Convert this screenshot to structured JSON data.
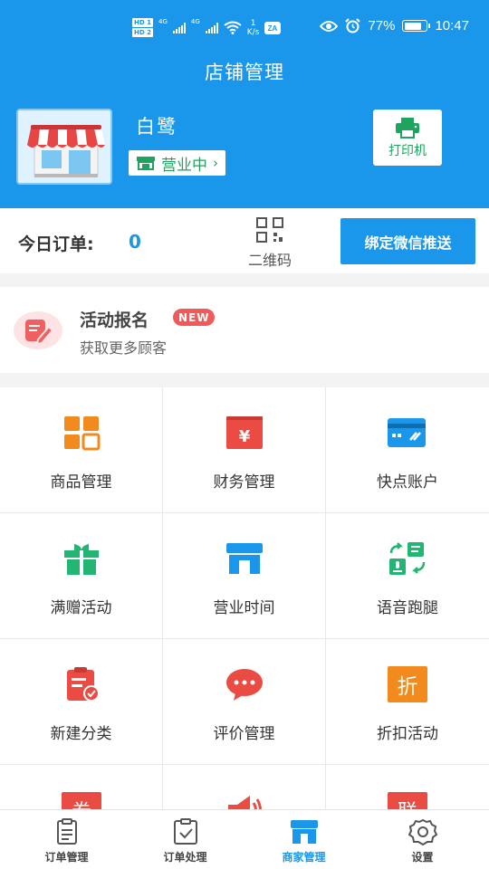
{
  "status_bar": {
    "hd1": "HD 1",
    "hd2": "HD 2",
    "net1": "4G",
    "net2": "4G",
    "speed_value": "1",
    "speed_unit": "K/s",
    "battery": "77%",
    "time": "10:47"
  },
  "header": {
    "title": "店铺管理",
    "shop_name": "白鹭",
    "open_status": "营业中",
    "printer_label": "打印机"
  },
  "orders": {
    "label": "今日订单:",
    "count": "0",
    "qr_label": "二维码",
    "wechat_button": "绑定微信推送"
  },
  "activity": {
    "title": "活动报名",
    "badge": "NEW",
    "subtitle": "获取更多顾客"
  },
  "grid": [
    {
      "label": "商品管理",
      "icon": "goods-grid-icon",
      "color": "#f28a1e"
    },
    {
      "label": "财务管理",
      "icon": "finance-yen-icon",
      "color": "#ea4b43"
    },
    {
      "label": "快点账户",
      "icon": "account-card-icon",
      "color": "#1a96ea"
    },
    {
      "label": "满赠活动",
      "icon": "gift-icon",
      "color": "#22b573"
    },
    {
      "label": "营业时间",
      "icon": "store-hours-icon",
      "color": "#1a96ea"
    },
    {
      "label": "语音跑腿",
      "icon": "voice-errand-icon",
      "color": "#22b573"
    },
    {
      "label": "新建分类",
      "icon": "new-category-icon",
      "color": "#ea4b43"
    },
    {
      "label": "评价管理",
      "icon": "review-chat-icon",
      "color": "#ea4b43"
    },
    {
      "label": "折扣活动",
      "icon": "discount-icon",
      "color": "#f28a1e",
      "glyph": "折"
    },
    {
      "label": "",
      "icon": "coupon-icon",
      "color": "#ea4b43",
      "glyph": "券"
    },
    {
      "label": "",
      "icon": "speaker-icon",
      "color": "#ea4b43"
    },
    {
      "label": "",
      "icon": "union-icon",
      "color": "#ea4b43",
      "glyph": "联"
    }
  ],
  "tabs": [
    {
      "label": "订单管理",
      "icon": "order-list-icon",
      "active": false
    },
    {
      "label": "订单处理",
      "icon": "order-check-icon",
      "active": false
    },
    {
      "label": "商家管理",
      "icon": "merchant-store-icon",
      "active": true
    },
    {
      "label": "设置",
      "icon": "settings-gear-icon",
      "active": false
    }
  ],
  "colors": {
    "brand_blue": "#1a96ea",
    "green": "#1ea45f",
    "red": "#ea4b43",
    "orange": "#f28a1e"
  }
}
